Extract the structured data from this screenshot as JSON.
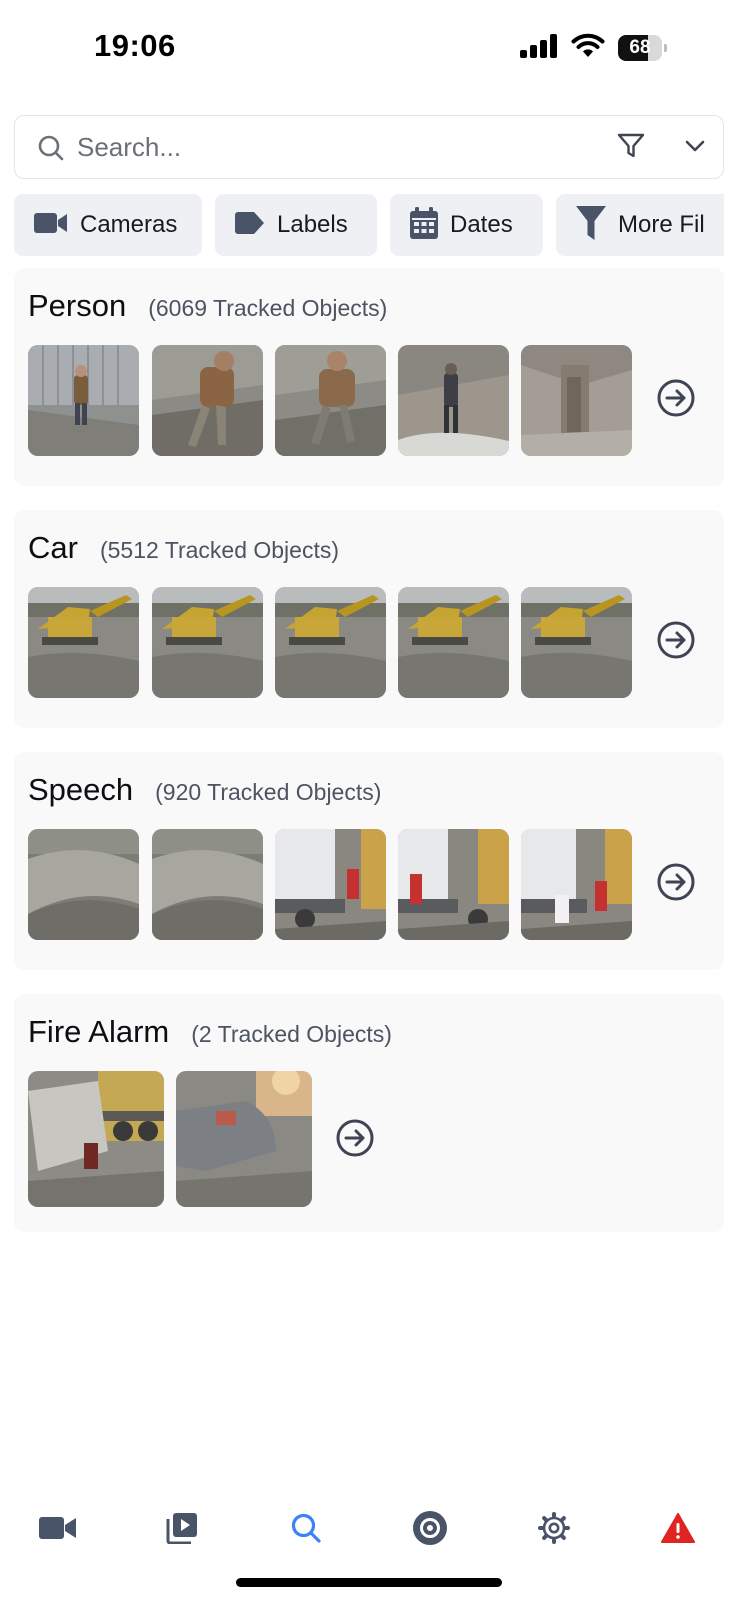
{
  "status_bar": {
    "time": "19:06",
    "battery_level": "68",
    "icons": [
      "cellular-signal-icon",
      "wifi-icon",
      "battery-icon"
    ]
  },
  "search": {
    "placeholder": "Search...",
    "value": ""
  },
  "filters": [
    {
      "label": "Cameras",
      "icon": "video-camera-icon"
    },
    {
      "label": "Labels",
      "icon": "tag-icon"
    },
    {
      "label": "Dates",
      "icon": "calendar-icon"
    },
    {
      "label": "More Fil",
      "icon": "filter-icon"
    }
  ],
  "sections": [
    {
      "title": "Person",
      "count": "(6069 Tracked Objects)",
      "thumbnail_count": 5
    },
    {
      "title": "Car",
      "count": "(5512 Tracked Objects)",
      "thumbnail_count": 5
    },
    {
      "title": "Speech",
      "count": "(920 Tracked Objects)",
      "thumbnail_count": 5
    },
    {
      "title": "Fire Alarm",
      "count": "(2 Tracked Objects)",
      "thumbnail_count": 2
    }
  ],
  "bottom_nav": [
    {
      "icon": "video-camera-icon",
      "active": false
    },
    {
      "icon": "playback-icon",
      "active": false
    },
    {
      "icon": "search-icon",
      "active": true
    },
    {
      "icon": "record-disc-icon",
      "active": false
    },
    {
      "icon": "gear-icon",
      "active": false
    },
    {
      "icon": "alert-triangle-icon",
      "active": false
    }
  ],
  "colors": {
    "accent": "#3b82f6",
    "icon": "#4a5468",
    "alert": "#e02424",
    "section_bg": "#f9f9fa",
    "chip_bg": "#eef0f3"
  }
}
